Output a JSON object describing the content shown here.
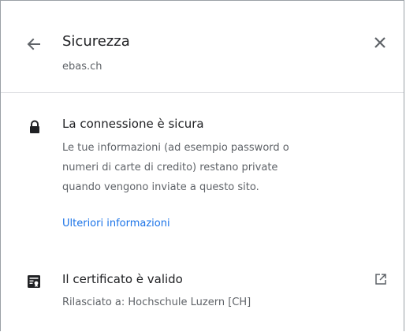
{
  "header": {
    "title": "Sicurezza",
    "subtitle": "ebas.ch",
    "back_icon": "arrow-back-icon",
    "close_icon": "close-icon"
  },
  "connection": {
    "icon": "lock-icon",
    "title": "La connessione è sicura",
    "description_lines": [
      "Le tue informazioni (ad esempio password o",
      "numeri di carte di credito) restano private",
      "quando vengono inviate a questo sito."
    ],
    "link": "Ulteriori informazioni"
  },
  "certificate": {
    "icon": "certificate-icon",
    "title": "Il certificato è valido",
    "subtitle": "Rilasciato a: Hochschule Luzern [CH]",
    "action_icon": "open-external-icon"
  },
  "colors": {
    "text_primary": "#202124",
    "text_secondary": "#5f6368",
    "link": "#1a73e8",
    "divider": "#dadce0",
    "icon": "#5f6368"
  }
}
